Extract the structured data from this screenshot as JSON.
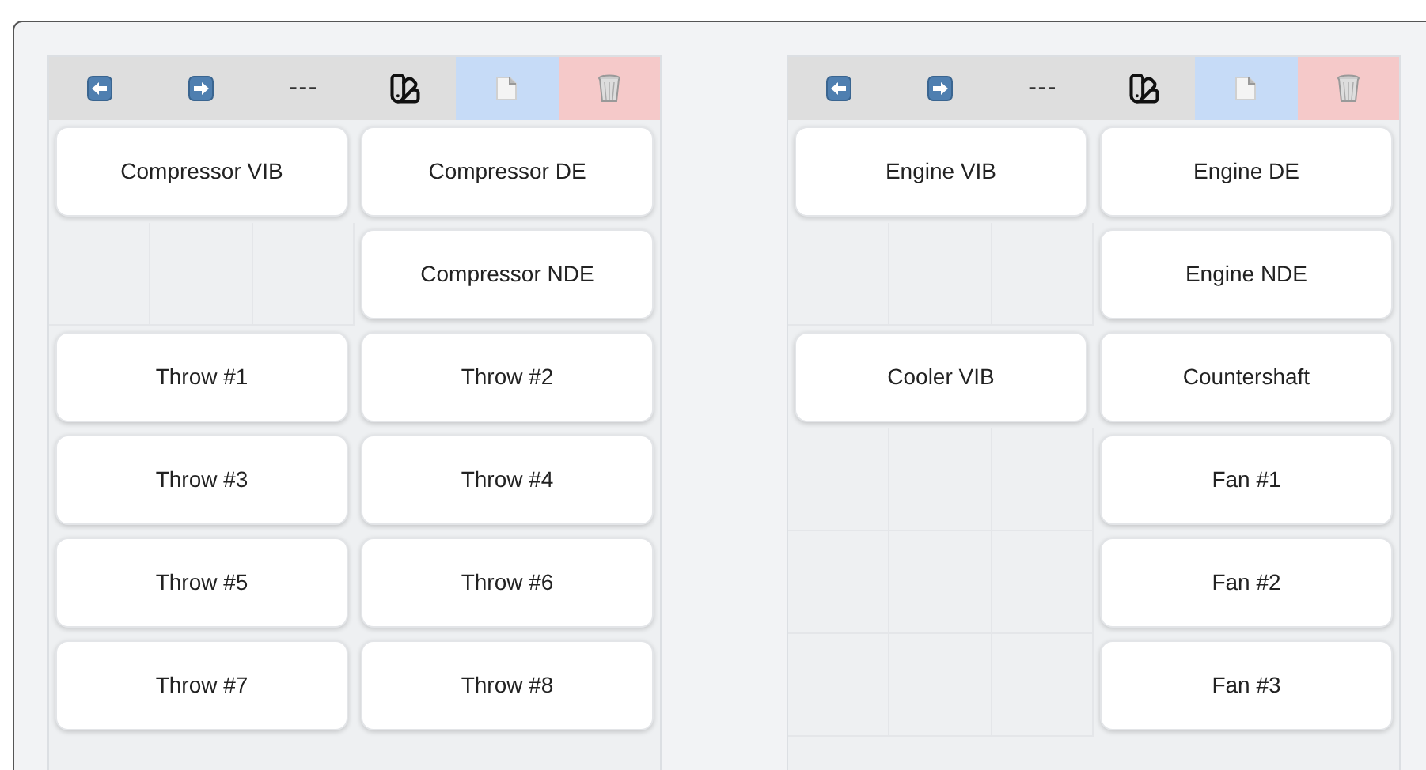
{
  "panels": [
    {
      "toolbar": {
        "separator": "---"
      },
      "rows": [
        [
          {
            "kind": "button",
            "label": "Compressor VIB"
          },
          {
            "kind": "button",
            "label": "Compressor DE"
          }
        ],
        [
          {
            "kind": "empty"
          },
          {
            "kind": "button",
            "label": "Compressor NDE"
          }
        ],
        [
          {
            "kind": "button",
            "label": "Throw #1"
          },
          {
            "kind": "button",
            "label": "Throw #2"
          }
        ],
        [
          {
            "kind": "button",
            "label": "Throw #3"
          },
          {
            "kind": "button",
            "label": "Throw #4"
          }
        ],
        [
          {
            "kind": "button",
            "label": "Throw #5"
          },
          {
            "kind": "button",
            "label": "Throw #6"
          }
        ],
        [
          {
            "kind": "button",
            "label": "Throw #7"
          },
          {
            "kind": "button",
            "label": "Throw #8"
          }
        ]
      ]
    },
    {
      "toolbar": {
        "separator": "---"
      },
      "rows": [
        [
          {
            "kind": "button",
            "label": "Engine VIB"
          },
          {
            "kind": "button",
            "label": "Engine DE"
          }
        ],
        [
          {
            "kind": "empty"
          },
          {
            "kind": "button",
            "label": "Engine NDE"
          }
        ],
        [
          {
            "kind": "button",
            "label": "Cooler VIB"
          },
          {
            "kind": "button",
            "label": "Countershaft"
          }
        ],
        [
          {
            "kind": "empty"
          },
          {
            "kind": "button",
            "label": "Fan #1"
          }
        ],
        [
          {
            "kind": "empty"
          },
          {
            "kind": "button",
            "label": "Fan #2"
          }
        ],
        [
          {
            "kind": "empty"
          },
          {
            "kind": "button",
            "label": "Fan #3"
          }
        ]
      ]
    }
  ]
}
